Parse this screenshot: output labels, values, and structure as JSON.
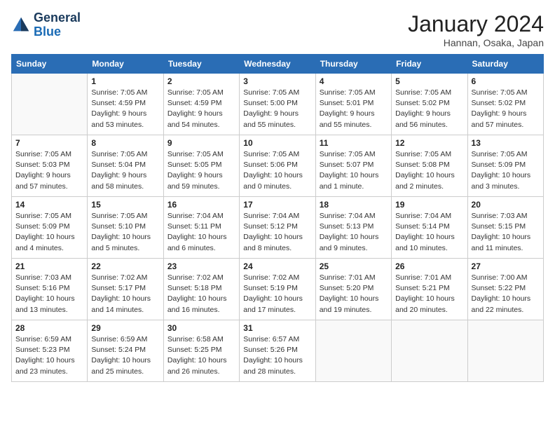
{
  "header": {
    "logo_line1": "General",
    "logo_line2": "Blue",
    "month": "January 2024",
    "location": "Hannan, Osaka, Japan"
  },
  "columns": [
    "Sunday",
    "Monday",
    "Tuesday",
    "Wednesday",
    "Thursday",
    "Friday",
    "Saturday"
  ],
  "weeks": [
    [
      {
        "day": "",
        "info": ""
      },
      {
        "day": "1",
        "info": "Sunrise: 7:05 AM\nSunset: 4:59 PM\nDaylight: 9 hours\nand 53 minutes."
      },
      {
        "day": "2",
        "info": "Sunrise: 7:05 AM\nSunset: 4:59 PM\nDaylight: 9 hours\nand 54 minutes."
      },
      {
        "day": "3",
        "info": "Sunrise: 7:05 AM\nSunset: 5:00 PM\nDaylight: 9 hours\nand 55 minutes."
      },
      {
        "day": "4",
        "info": "Sunrise: 7:05 AM\nSunset: 5:01 PM\nDaylight: 9 hours\nand 55 minutes."
      },
      {
        "day": "5",
        "info": "Sunrise: 7:05 AM\nSunset: 5:02 PM\nDaylight: 9 hours\nand 56 minutes."
      },
      {
        "day": "6",
        "info": "Sunrise: 7:05 AM\nSunset: 5:02 PM\nDaylight: 9 hours\nand 57 minutes."
      }
    ],
    [
      {
        "day": "7",
        "info": "Sunrise: 7:05 AM\nSunset: 5:03 PM\nDaylight: 9 hours\nand 57 minutes."
      },
      {
        "day": "8",
        "info": "Sunrise: 7:05 AM\nSunset: 5:04 PM\nDaylight: 9 hours\nand 58 minutes."
      },
      {
        "day": "9",
        "info": "Sunrise: 7:05 AM\nSunset: 5:05 PM\nDaylight: 9 hours\nand 59 minutes."
      },
      {
        "day": "10",
        "info": "Sunrise: 7:05 AM\nSunset: 5:06 PM\nDaylight: 10 hours\nand 0 minutes."
      },
      {
        "day": "11",
        "info": "Sunrise: 7:05 AM\nSunset: 5:07 PM\nDaylight: 10 hours\nand 1 minute."
      },
      {
        "day": "12",
        "info": "Sunrise: 7:05 AM\nSunset: 5:08 PM\nDaylight: 10 hours\nand 2 minutes."
      },
      {
        "day": "13",
        "info": "Sunrise: 7:05 AM\nSunset: 5:09 PM\nDaylight: 10 hours\nand 3 minutes."
      }
    ],
    [
      {
        "day": "14",
        "info": "Sunrise: 7:05 AM\nSunset: 5:09 PM\nDaylight: 10 hours\nand 4 minutes."
      },
      {
        "day": "15",
        "info": "Sunrise: 7:05 AM\nSunset: 5:10 PM\nDaylight: 10 hours\nand 5 minutes."
      },
      {
        "day": "16",
        "info": "Sunrise: 7:04 AM\nSunset: 5:11 PM\nDaylight: 10 hours\nand 6 minutes."
      },
      {
        "day": "17",
        "info": "Sunrise: 7:04 AM\nSunset: 5:12 PM\nDaylight: 10 hours\nand 8 minutes."
      },
      {
        "day": "18",
        "info": "Sunrise: 7:04 AM\nSunset: 5:13 PM\nDaylight: 10 hours\nand 9 minutes."
      },
      {
        "day": "19",
        "info": "Sunrise: 7:04 AM\nSunset: 5:14 PM\nDaylight: 10 hours\nand 10 minutes."
      },
      {
        "day": "20",
        "info": "Sunrise: 7:03 AM\nSunset: 5:15 PM\nDaylight: 10 hours\nand 11 minutes."
      }
    ],
    [
      {
        "day": "21",
        "info": "Sunrise: 7:03 AM\nSunset: 5:16 PM\nDaylight: 10 hours\nand 13 minutes."
      },
      {
        "day": "22",
        "info": "Sunrise: 7:02 AM\nSunset: 5:17 PM\nDaylight: 10 hours\nand 14 minutes."
      },
      {
        "day": "23",
        "info": "Sunrise: 7:02 AM\nSunset: 5:18 PM\nDaylight: 10 hours\nand 16 minutes."
      },
      {
        "day": "24",
        "info": "Sunrise: 7:02 AM\nSunset: 5:19 PM\nDaylight: 10 hours\nand 17 minutes."
      },
      {
        "day": "25",
        "info": "Sunrise: 7:01 AM\nSunset: 5:20 PM\nDaylight: 10 hours\nand 19 minutes."
      },
      {
        "day": "26",
        "info": "Sunrise: 7:01 AM\nSunset: 5:21 PM\nDaylight: 10 hours\nand 20 minutes."
      },
      {
        "day": "27",
        "info": "Sunrise: 7:00 AM\nSunset: 5:22 PM\nDaylight: 10 hours\nand 22 minutes."
      }
    ],
    [
      {
        "day": "28",
        "info": "Sunrise: 6:59 AM\nSunset: 5:23 PM\nDaylight: 10 hours\nand 23 minutes."
      },
      {
        "day": "29",
        "info": "Sunrise: 6:59 AM\nSunset: 5:24 PM\nDaylight: 10 hours\nand 25 minutes."
      },
      {
        "day": "30",
        "info": "Sunrise: 6:58 AM\nSunset: 5:25 PM\nDaylight: 10 hours\nand 26 minutes."
      },
      {
        "day": "31",
        "info": "Sunrise: 6:57 AM\nSunset: 5:26 PM\nDaylight: 10 hours\nand 28 minutes."
      },
      {
        "day": "",
        "info": ""
      },
      {
        "day": "",
        "info": ""
      },
      {
        "day": "",
        "info": ""
      }
    ]
  ]
}
